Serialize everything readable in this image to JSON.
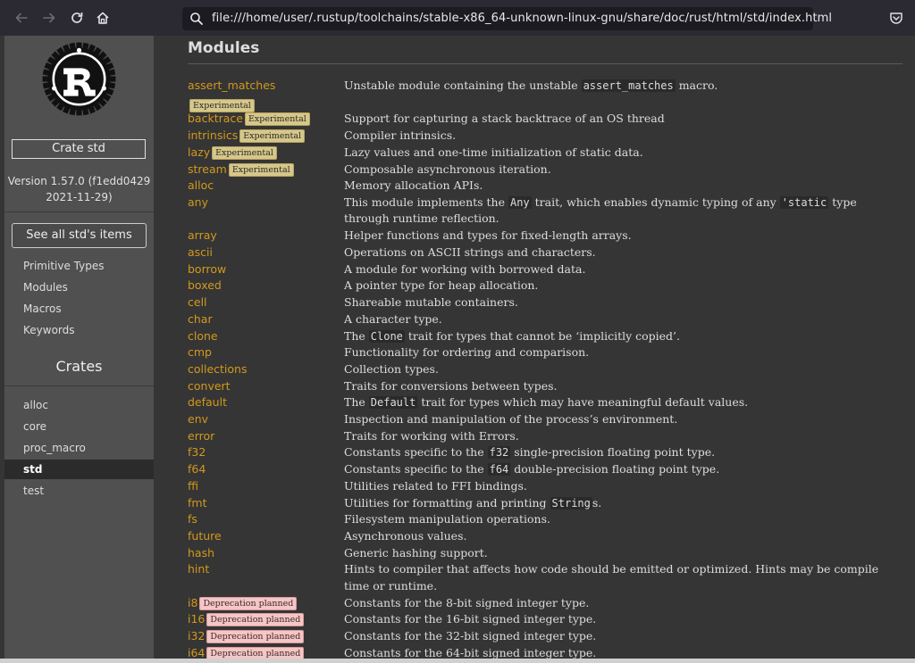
{
  "browser": {
    "url": "file:///home/user/.rustup/toolchains/stable-x86_64-unknown-linux-gnu/share/doc/rust/html/std/index.html"
  },
  "sidebar": {
    "crate_label": "Crate std",
    "version_line1": "Version 1.57.0 (f1edd0429",
    "version_line2": "2021-11-29)",
    "see_all_label": "See all std's items",
    "links": [
      "Primitive Types",
      "Modules",
      "Macros",
      "Keywords"
    ],
    "crates_heading": "Crates",
    "crates": [
      "alloc",
      "core",
      "proc_macro",
      "std",
      "test"
    ],
    "current_crate": "std"
  },
  "main": {
    "heading": "Modules",
    "modules": [
      {
        "name": "assert_matches",
        "badge": "Experimental",
        "badge_type": "exp",
        "badge_newline": true,
        "desc": [
          {
            "t": "Unstable module containing the unstable "
          },
          {
            "c": "assert_matches"
          },
          {
            "t": " macro."
          }
        ]
      },
      {
        "name": "backtrace",
        "badge": "Experimental",
        "badge_type": "exp",
        "desc": [
          {
            "t": "Support for capturing a stack backtrace of an OS thread"
          }
        ]
      },
      {
        "name": "intrinsics",
        "badge": "Experimental",
        "badge_type": "exp",
        "desc": [
          {
            "t": "Compiler intrinsics."
          }
        ]
      },
      {
        "name": "lazy",
        "badge": "Experimental",
        "badge_type": "exp",
        "desc": [
          {
            "t": "Lazy values and one-time initialization of static data."
          }
        ]
      },
      {
        "name": "stream",
        "badge": "Experimental",
        "badge_type": "exp",
        "desc": [
          {
            "t": "Composable asynchronous iteration."
          }
        ]
      },
      {
        "name": "alloc",
        "desc": [
          {
            "t": "Memory allocation APIs."
          }
        ]
      },
      {
        "name": "any",
        "lines": 2,
        "desc": [
          {
            "t": "This module implements the "
          },
          {
            "c": "Any"
          },
          {
            "t": " trait, which enables dynamic typing of any "
          },
          {
            "c": "'static"
          },
          {
            "t": " type through runtime reflection."
          }
        ]
      },
      {
        "name": "array",
        "desc": [
          {
            "t": "Helper functions and types for fixed-length arrays."
          }
        ]
      },
      {
        "name": "ascii",
        "desc": [
          {
            "t": "Operations on ASCII strings and characters."
          }
        ]
      },
      {
        "name": "borrow",
        "desc": [
          {
            "t": "A module for working with borrowed data."
          }
        ]
      },
      {
        "name": "boxed",
        "desc": [
          {
            "t": "A pointer type for heap allocation."
          }
        ]
      },
      {
        "name": "cell",
        "desc": [
          {
            "t": "Shareable mutable containers."
          }
        ]
      },
      {
        "name": "char",
        "desc": [
          {
            "t": "A character type."
          }
        ]
      },
      {
        "name": "clone",
        "desc": [
          {
            "t": "The "
          },
          {
            "c": "Clone"
          },
          {
            "t": " trait for types that cannot be ‘implicitly copied’."
          }
        ]
      },
      {
        "name": "cmp",
        "desc": [
          {
            "t": "Functionality for ordering and comparison."
          }
        ]
      },
      {
        "name": "collections",
        "desc": [
          {
            "t": "Collection types."
          }
        ]
      },
      {
        "name": "convert",
        "desc": [
          {
            "t": "Traits for conversions between types."
          }
        ]
      },
      {
        "name": "default",
        "desc": [
          {
            "t": "The "
          },
          {
            "c": "Default"
          },
          {
            "t": " trait for types which may have meaningful default values."
          }
        ]
      },
      {
        "name": "env",
        "desc": [
          {
            "t": "Inspection and manipulation of the process’s environment."
          }
        ]
      },
      {
        "name": "error",
        "desc": [
          {
            "t": "Traits for working with Errors."
          }
        ]
      },
      {
        "name": "f32",
        "desc": [
          {
            "t": "Constants specific to the "
          },
          {
            "c": "f32"
          },
          {
            "t": " single-precision floating point type."
          }
        ]
      },
      {
        "name": "f64",
        "desc": [
          {
            "t": "Constants specific to the "
          },
          {
            "c": "f64"
          },
          {
            "t": " double-precision floating point type."
          }
        ]
      },
      {
        "name": "ffi",
        "desc": [
          {
            "t": "Utilities related to FFI bindings."
          }
        ]
      },
      {
        "name": "fmt",
        "desc": [
          {
            "t": "Utilities for formatting and printing "
          },
          {
            "c": "String"
          },
          {
            "t": "s."
          }
        ]
      },
      {
        "name": "fs",
        "desc": [
          {
            "t": "Filesystem manipulation operations."
          }
        ]
      },
      {
        "name": "future",
        "desc": [
          {
            "t": "Asynchronous values."
          }
        ]
      },
      {
        "name": "hash",
        "desc": [
          {
            "t": "Generic hashing support."
          }
        ]
      },
      {
        "name": "hint",
        "lines": 2,
        "desc": [
          {
            "t": "Hints to compiler that affects how code should be emitted or optimized. Hints may be compile time or runtime."
          }
        ]
      },
      {
        "name": "i8",
        "badge": "Deprecation planned",
        "badge_type": "dep",
        "desc": [
          {
            "t": "Constants for the 8-bit signed integer type."
          }
        ]
      },
      {
        "name": "i16",
        "badge": "Deprecation planned",
        "badge_type": "dep",
        "desc": [
          {
            "t": "Constants for the 16-bit signed integer type."
          }
        ]
      },
      {
        "name": "i32",
        "badge": "Deprecation planned",
        "badge_type": "dep",
        "desc": [
          {
            "t": "Constants for the 32-bit signed integer type."
          }
        ]
      },
      {
        "name": "i64",
        "badge": "Deprecation planned",
        "badge_type": "dep",
        "desc": [
          {
            "t": "Constants for the 64-bit signed integer type."
          }
        ]
      }
    ]
  }
}
